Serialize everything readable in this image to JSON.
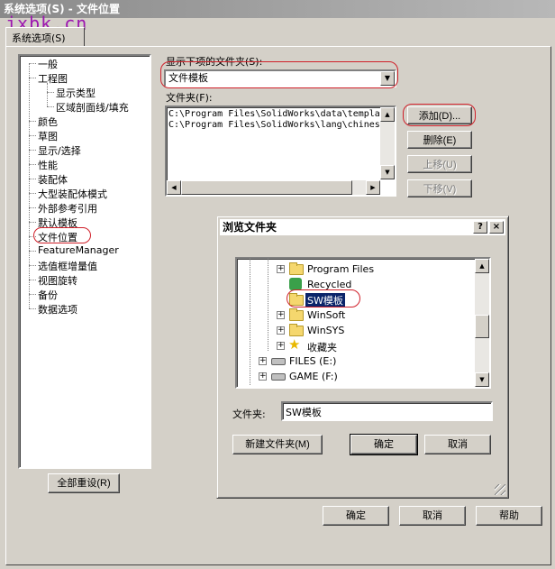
{
  "window": {
    "title": "系统选项(S) - 文件位置"
  },
  "watermark": "jxbk.cn",
  "tab": {
    "label": "系统选项(S)"
  },
  "tree": {
    "items": [
      {
        "label": "一般"
      },
      {
        "label": "工程图"
      },
      {
        "label": "显示类型"
      },
      {
        "label": "区域剖面线/填充"
      },
      {
        "label": "颜色"
      },
      {
        "label": "草图"
      },
      {
        "label": "显示/选择"
      },
      {
        "label": "性能"
      },
      {
        "label": "装配体"
      },
      {
        "label": "大型装配体模式"
      },
      {
        "label": "外部参考引用"
      },
      {
        "label": "默认模板"
      },
      {
        "label": "文件位置"
      },
      {
        "label": "FeatureManager"
      },
      {
        "label": "选值框增量值"
      },
      {
        "label": "视图旋转"
      },
      {
        "label": "备份"
      },
      {
        "label": "数据选项"
      }
    ],
    "reset_button": "全部重设(R)"
  },
  "folders": {
    "show_label": "显示下项的文件夹(S):",
    "show_value": "文件模板",
    "folders_label": "文件夹(F):",
    "list": [
      "C:\\Program Files\\SolidWorks\\data\\templa",
      "C:\\Program Files\\SolidWorks\\lang\\chines"
    ],
    "add_button": "添加(D)...",
    "delete_button": "删除(E)",
    "up_button": "上移(U)",
    "down_button": "下移(V)"
  },
  "browse": {
    "title": "浏览文件夹",
    "help_glyph": "?",
    "close_glyph": "×",
    "nodes": [
      {
        "label": "Program Files"
      },
      {
        "label": "Recycled"
      },
      {
        "label": "SW模板"
      },
      {
        "label": "WinSoft"
      },
      {
        "label": "WinSYS"
      },
      {
        "label": "收藏夹"
      },
      {
        "label": "FILES (E:)"
      },
      {
        "label": "GAME (F:)"
      }
    ],
    "folder_label": "文件夹:",
    "folder_value": "SW模板",
    "new_folder_button": "新建文件夹(M)",
    "ok_button": "确定",
    "cancel_button": "取消"
  },
  "footer": {
    "ok": "确定",
    "cancel": "取消",
    "help": "帮助"
  },
  "colors": {
    "annotation_red": "#d0202a",
    "watermark": "#9d17b0",
    "selection": "#0a246a"
  }
}
